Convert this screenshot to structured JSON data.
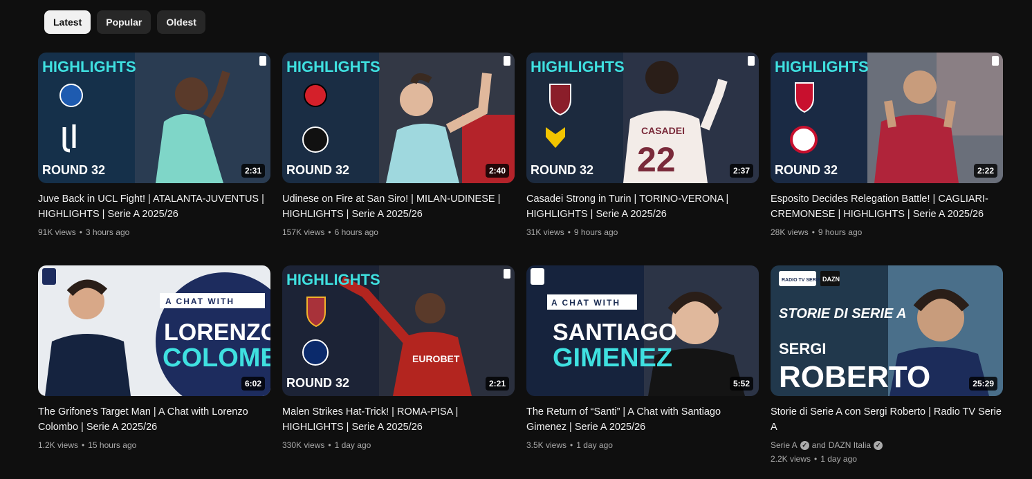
{
  "chips": [
    {
      "label": "Latest",
      "active": true
    },
    {
      "label": "Popular",
      "active": false
    },
    {
      "label": "Oldest",
      "active": false
    }
  ],
  "videos": [
    {
      "title": "Juve Back in UCL Fight! | ATALANTA-JUVENTUS | HIGHLIGHTS | Serie A 2025/26",
      "views": "91K views",
      "age": "3 hours ago",
      "duration": "2:31",
      "thumb": {
        "banner": "HIGHLIGHTS",
        "round": "ROUND 32",
        "bg": "#15304a",
        "jersey": "#7fd6c8"
      }
    },
    {
      "title": "Udinese on Fire at San Siro! | MILAN-UDINESE | HIGHLIGHTS | Serie A 2025/26",
      "views": "157K views",
      "age": "6 hours ago",
      "duration": "2:40",
      "thumb": {
        "banner": "HIGHLIGHTS",
        "round": "ROUND 32",
        "bg": "#1a2d44",
        "jersey": "#9fd8de"
      }
    },
    {
      "title": "Casadei Strong in Turin | TORINO-VERONA | HIGHLIGHTS | Serie A 2025/26",
      "views": "31K views",
      "age": "9 hours ago",
      "duration": "2:37",
      "thumb": {
        "banner": "HIGHLIGHTS",
        "round": "ROUND 32",
        "bg": "#1c2a3e",
        "jersey": "#f3ece8",
        "jersey_text": "CASADEI 22"
      }
    },
    {
      "title": "Esposito Decides Relegation Battle! | CAGLIARI-CREMONESE | HIGHLIGHTS | Serie A 2025/26",
      "views": "28K views",
      "age": "9 hours ago",
      "duration": "2:22",
      "thumb": {
        "banner": "HIGHLIGHTS",
        "round": "ROUND 32",
        "bg": "#1a2a44",
        "jersey": "#b0243a"
      }
    },
    {
      "title": "The Grifone's Target Man | A Chat with Lorenzo Colombo | Serie A 2025/26",
      "views": "1.2K views",
      "age": "15 hours ago",
      "duration": "6:02",
      "thumb": {
        "chat": "A CHAT WITH",
        "name1": "LORENZO",
        "name2": "COLOMBO",
        "bg": "#e9ecf0",
        "panel": "#1d2c5e",
        "accent": "#3fe0e0"
      }
    },
    {
      "title": "Malen Strikes Hat-Trick! | ROMA-PISA | HIGHLIGHTS | Serie A 2025/26",
      "views": "330K views",
      "age": "1 day ago",
      "duration": "2:21",
      "thumb": {
        "banner": "HIGHLIGHTS",
        "round": "ROUND 32",
        "bg": "#1c2336",
        "jersey": "#b3251f"
      }
    },
    {
      "title": "The Return of “Santi” | A Chat with Santiago Gimenez | Serie A 2025/26",
      "views": "3.5K views",
      "age": "1 day ago",
      "duration": "5:52",
      "thumb": {
        "chat": "A CHAT WITH",
        "name1": "SANTIAGO",
        "name2": "GIMENEZ",
        "bg": "#16233d",
        "panel": "#1a2b52",
        "accent": "#3fe0e0"
      }
    },
    {
      "title": "Storie di Serie A con Sergi Roberto | Radio TV Serie A",
      "channel_a": "Serie A",
      "channel_join": "and",
      "channel_b": "DAZN Italia",
      "views": "2.2K views",
      "age": "1 day ago",
      "duration": "25:29",
      "thumb": {
        "series": "STORIE DI SERIE A",
        "name1": "SERGI",
        "name2": "ROBERTO",
        "badge_a": "RADIO TV SERIE A",
        "badge_b": "DAZN",
        "bg": "#21384c"
      }
    }
  ]
}
